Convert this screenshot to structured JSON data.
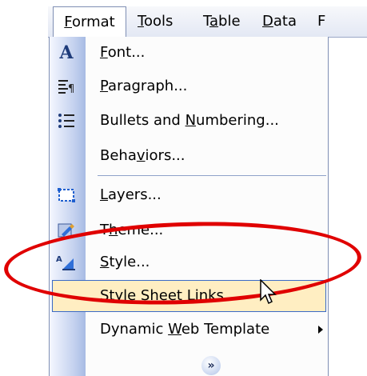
{
  "menubar": {
    "format": "Format",
    "tools": "Tools",
    "table": "Table",
    "data": "Data",
    "more": "F"
  },
  "menu": {
    "items": [
      {
        "label_pre": "",
        "label_u": "F",
        "label_post": "ont...",
        "icon": "font-icon"
      },
      {
        "label_pre": "",
        "label_u": "P",
        "label_post": "aragraph...",
        "icon": "paragraph-icon"
      },
      {
        "label_pre": "Bullets and ",
        "label_u": "N",
        "label_post": "umbering...",
        "icon": "bullets-icon"
      },
      {
        "label_pre": "Beha",
        "label_u": "v",
        "label_post": "iors...",
        "icon": ""
      },
      {
        "label_pre": "",
        "label_u": "L",
        "label_post": "ayers...",
        "icon": "layers-icon"
      },
      {
        "label_pre": "T",
        "label_u": "h",
        "label_post": "eme...",
        "icon": "theme-icon"
      },
      {
        "label_pre": "",
        "label_u": "S",
        "label_post": "tyle...",
        "icon": "style-icon"
      },
      {
        "label_pre": "Style Sheet Links...",
        "label_u": "",
        "label_post": "",
        "icon": ""
      },
      {
        "label_pre": "Dynamic ",
        "label_u": "W",
        "label_post": "eb Template",
        "icon": ""
      }
    ],
    "highlight_color": "#ffeec2",
    "annotation_color": "#e00000"
  }
}
